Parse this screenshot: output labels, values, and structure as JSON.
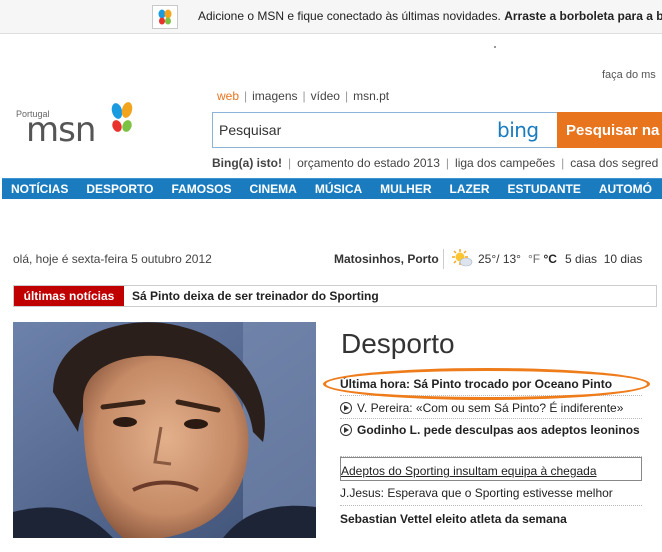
{
  "notification": {
    "message": "Adicione o MSN e fique conectado às últimas novidades.",
    "message_bold": "Arraste a borboleta para a b"
  },
  "header": {
    "faca": "faça do ms",
    "logo_country": "Portugal",
    "logo_text": "msn"
  },
  "search": {
    "tabs": [
      "web",
      "imagens",
      "vídeo",
      "msn.pt"
    ],
    "active_tab": "web",
    "placeholder": "Pesquisar",
    "engine_logo": "bing",
    "button_label": "Pesquisar na",
    "links": [
      "Bing(a) isto!",
      "orçamento do estado 2013",
      "liga dos campeões",
      "casa dos segred"
    ]
  },
  "nav": {
    "items": [
      "NOTÍCIAS",
      "DESPORTO",
      "FAMOSOS",
      "CINEMA",
      "MÚSICA",
      "MULHER",
      "LAZER",
      "ESTUDANTE",
      "AUTOMÓ"
    ]
  },
  "greeting": "olá, hoje é sexta-feira 5 outubro 2012",
  "weather": {
    "location": "Matosinhos, Porto",
    "temperature": "25°/ 13°",
    "unit_f": "°F",
    "unit_c": "°C",
    "forecast_5": "5 dias",
    "forecast_10": "10 dias",
    "icon": "sun-icon"
  },
  "breaking": {
    "label": "últimas notícias",
    "text": "Sá Pinto deixa de ser treinador do Sporting"
  },
  "section": {
    "title": "Desporto",
    "headlines": [
      {
        "text": "Última hora: Sá Pinto trocado por Oceano Pinto"
      },
      {
        "text": "V. Pereira: «Com ou sem Sá Pinto? É indiferente»"
      },
      {
        "text": "Godinho L. pede desculpas aos adeptos leoninos"
      },
      {
        "text": "Adeptos do Sporting insultam equipa à chegada"
      },
      {
        "text": "J.Jesus: Esperava que o Sporting estivesse melhor"
      },
      {
        "text": "Sebastian Vettel eleito atleta da semana"
      }
    ]
  },
  "colors": {
    "nav_blue": "#1a7cbf",
    "accent_orange": "#e8741e",
    "breaking_red": "#c00000",
    "highlight_ring": "#ef7c1a"
  }
}
